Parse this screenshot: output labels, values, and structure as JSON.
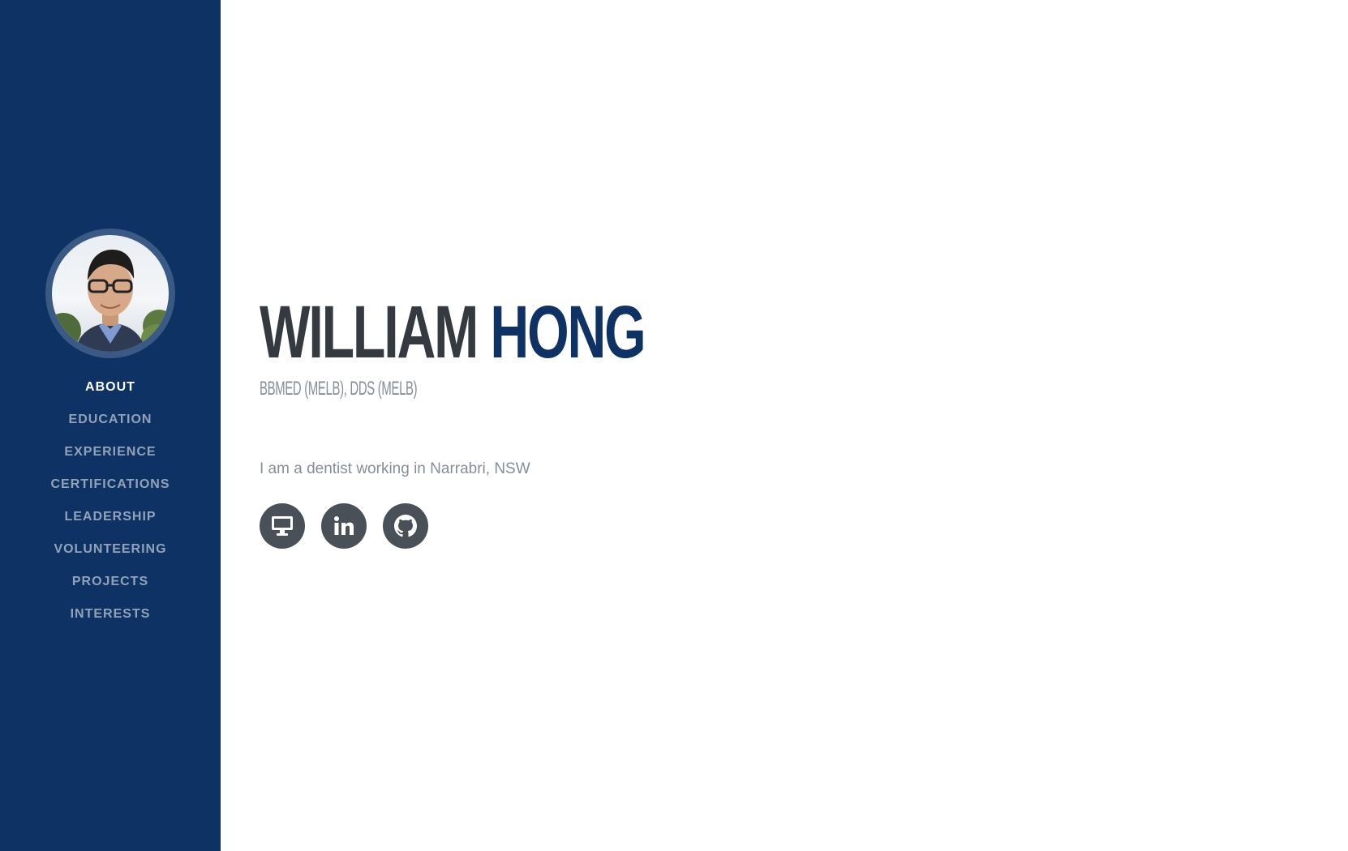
{
  "sidebar": {
    "avatar_alt": "Profile photo",
    "nav": [
      {
        "label": "About",
        "active": true
      },
      {
        "label": "Education"
      },
      {
        "label": "Experience"
      },
      {
        "label": "Certifications"
      },
      {
        "label": "Leadership"
      },
      {
        "label": "Volunteering"
      },
      {
        "label": "Projects"
      },
      {
        "label": "Interests"
      }
    ]
  },
  "about": {
    "first_name": "WILLIAM",
    "last_name": "HONG",
    "credentials": "BBMED (MELB), DDS (MELB)",
    "lead": "I am a dentist working in Narrabri, NSW",
    "social": [
      {
        "icon": "desktop-icon"
      },
      {
        "icon": "linkedin-icon"
      },
      {
        "icon": "github-icon"
      }
    ]
  },
  "colors": {
    "sidebar_bg": "#0d3263",
    "accent": "#0d3263",
    "heading": "#343a40",
    "muted": "#868e96",
    "social_bg": "#495057"
  }
}
